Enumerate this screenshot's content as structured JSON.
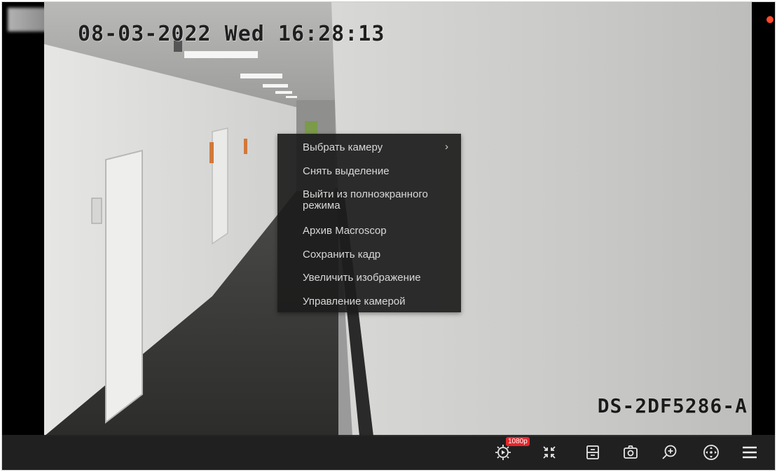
{
  "osd": {
    "timestamp": "08-03-2022 Wed 16:28:13",
    "model": "DS-2DF5286-A"
  },
  "context_menu": {
    "items": [
      {
        "label": "Выбрать камеру",
        "has_submenu": true
      },
      {
        "label": "Снять выделение"
      },
      {
        "label": "Выйти из полноэкранного режима"
      },
      {
        "label": "Архив Macroscop"
      },
      {
        "label": "Сохранить кадр"
      },
      {
        "label": "Увеличить изображение"
      },
      {
        "label": "Управление камерой"
      }
    ]
  },
  "toolbar": {
    "quality_badge": "1080p",
    "buttons": [
      {
        "icon": "settings-icon"
      },
      {
        "icon": "exit-fullscreen-icon"
      },
      {
        "icon": "archive-icon"
      },
      {
        "icon": "snapshot-icon"
      },
      {
        "icon": "zoom-in-icon"
      },
      {
        "icon": "ptz-icon"
      },
      {
        "icon": "menu-icon"
      }
    ]
  },
  "colors": {
    "recording_indicator": "#ff4b2b",
    "badge": "#e8262c"
  }
}
